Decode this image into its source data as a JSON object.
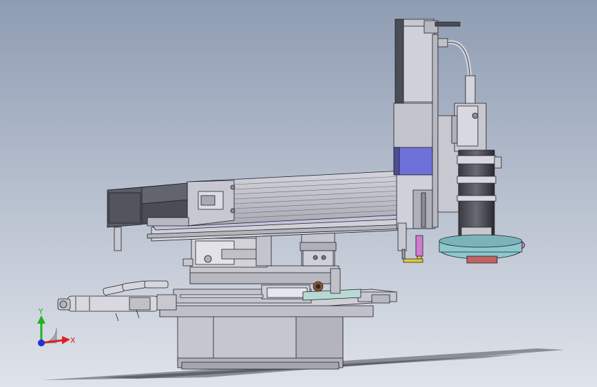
{
  "viewport": {
    "background_top": "#8e9cb2",
    "background_bottom": "#dfe3ea"
  },
  "colors": {
    "part_gray": "#c8c8cc",
    "part_gray_dark": "#9a9ca4",
    "edge": "#1c1c24",
    "lavender": "#c4c2dc",
    "motor_blue": "#6e72d8",
    "lens_black": "#2a2a30",
    "ring_teal": "#8cc8cc",
    "ring_red": "#c06464",
    "violet": "#d07ad0",
    "yellow": "#e0c640",
    "bronze": "#8a5a2a",
    "axis_x": "#e02020",
    "axis_y": "#20b020",
    "axis_z": "#2030d8"
  },
  "triad": {
    "x_label": "X",
    "y_label": "Y"
  }
}
